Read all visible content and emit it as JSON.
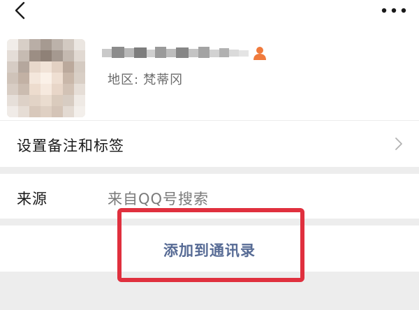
{
  "profile": {
    "name_redacted": true,
    "region_label": "地区:",
    "region_value": "梵蒂冈"
  },
  "settings_row": {
    "label": "设置备注和标签"
  },
  "source_row": {
    "label": "来源",
    "value": "来自QQ号搜索"
  },
  "action": {
    "label": "添加到通讯录"
  },
  "icons": {
    "back": "chevron-left-icon",
    "more": "more-dots-icon",
    "gender": "person-icon",
    "row_arrow": "chevron-right-icon"
  },
  "colors": {
    "background": "#ffffff",
    "section_gap": "#ededed",
    "link_blue": "#576b95",
    "highlight_red": "#e0303e",
    "gender_icon": "#f07a3c"
  }
}
